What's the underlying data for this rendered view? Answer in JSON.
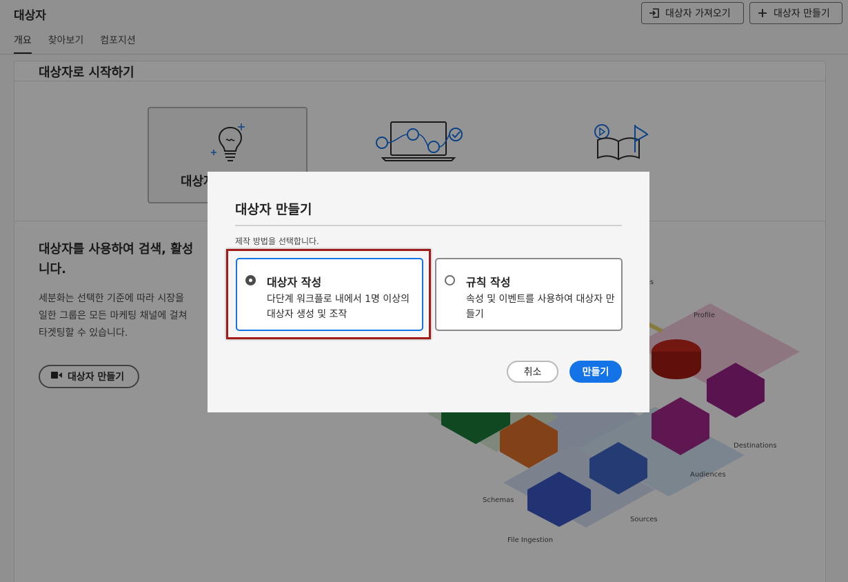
{
  "header": {
    "title": "대상자",
    "import_button": "대상자 가져오기",
    "create_button": "대상자 만들기"
  },
  "tabs": [
    {
      "label": "개요",
      "active": true
    },
    {
      "label": "찾아보기",
      "active": false
    },
    {
      "label": "컴포지션",
      "active": false
    }
  ],
  "card": {
    "title": "대상자로 시작하기",
    "tile_label": "대상자",
    "intro_heading": "대상자를 사용하여 검색, 활성",
    "intro_heading_2": "니다.",
    "intro_lines": [
      "세분화는 선택한 기준에 따라 시장을",
      "일한 그룹은 모든 마케팅 채널에 걸쳐",
      "타겟팅할 수 있습니다."
    ],
    "intro_button": "대상자 만들기"
  },
  "illustration": {
    "labels": {
      "ties": "ties",
      "profile": "Profile",
      "destinations": "Destinations",
      "audiences": "Audiences",
      "schemas": "Schemas",
      "sources": "Sources",
      "file_ingestion": "File Ingestion"
    }
  },
  "dialog": {
    "title": "대상자 만들기",
    "subtitle": "제작 방법을 선택합니다.",
    "options": [
      {
        "title": "대상자 작성",
        "description": "다단계 워크플로 내에서 1명 이상의 대상자 생성 및 조작",
        "selected": true
      },
      {
        "title": "규칙 작성",
        "description": "속성 및 이벤트를 사용하여 대상자 만들기",
        "selected": false
      }
    ],
    "cancel_label": "취소",
    "create_label": "만들기"
  },
  "colors": {
    "accent": "#1473e6",
    "highlight": "#a31a1a"
  }
}
